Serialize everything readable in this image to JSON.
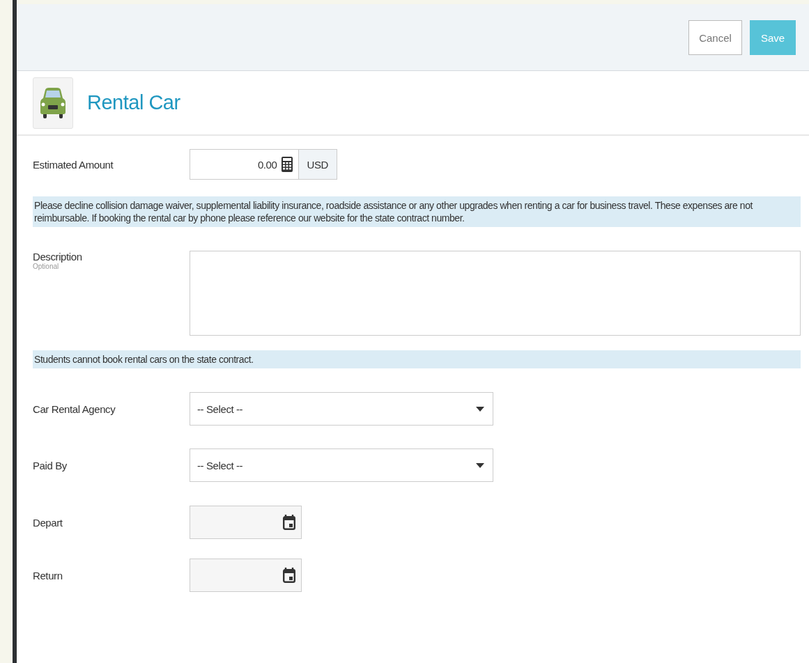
{
  "header": {
    "buttons": [
      {
        "label": "Cancel",
        "kind": "secondary"
      },
      {
        "label": "Save",
        "kind": "primary"
      }
    ]
  },
  "title": "Rental Car",
  "fields": [
    {
      "kind": "amount",
      "label": "Estimated Amount",
      "value": "0.00",
      "currency": "USD"
    },
    {
      "kind": "info",
      "text": "Please decline collision damage waiver, supplemental liability insurance, roadside assistance or any other upgrades when renting a car for business travel. These expenses are not reimbursable. If booking the rental car by phone please reference our website for the state contract number."
    },
    {
      "kind": "textarea",
      "label": "Description",
      "hint": "Optional"
    },
    {
      "kind": "info",
      "text": "Students cannot book rental cars on the state contract."
    },
    {
      "kind": "select",
      "label": "Car Rental Agency",
      "value": "-- Select --"
    },
    {
      "kind": "select",
      "label": "Paid By",
      "value": "-- Select --"
    },
    {
      "kind": "date",
      "label": "Depart"
    },
    {
      "kind": "date",
      "label": "Return"
    }
  ]
}
